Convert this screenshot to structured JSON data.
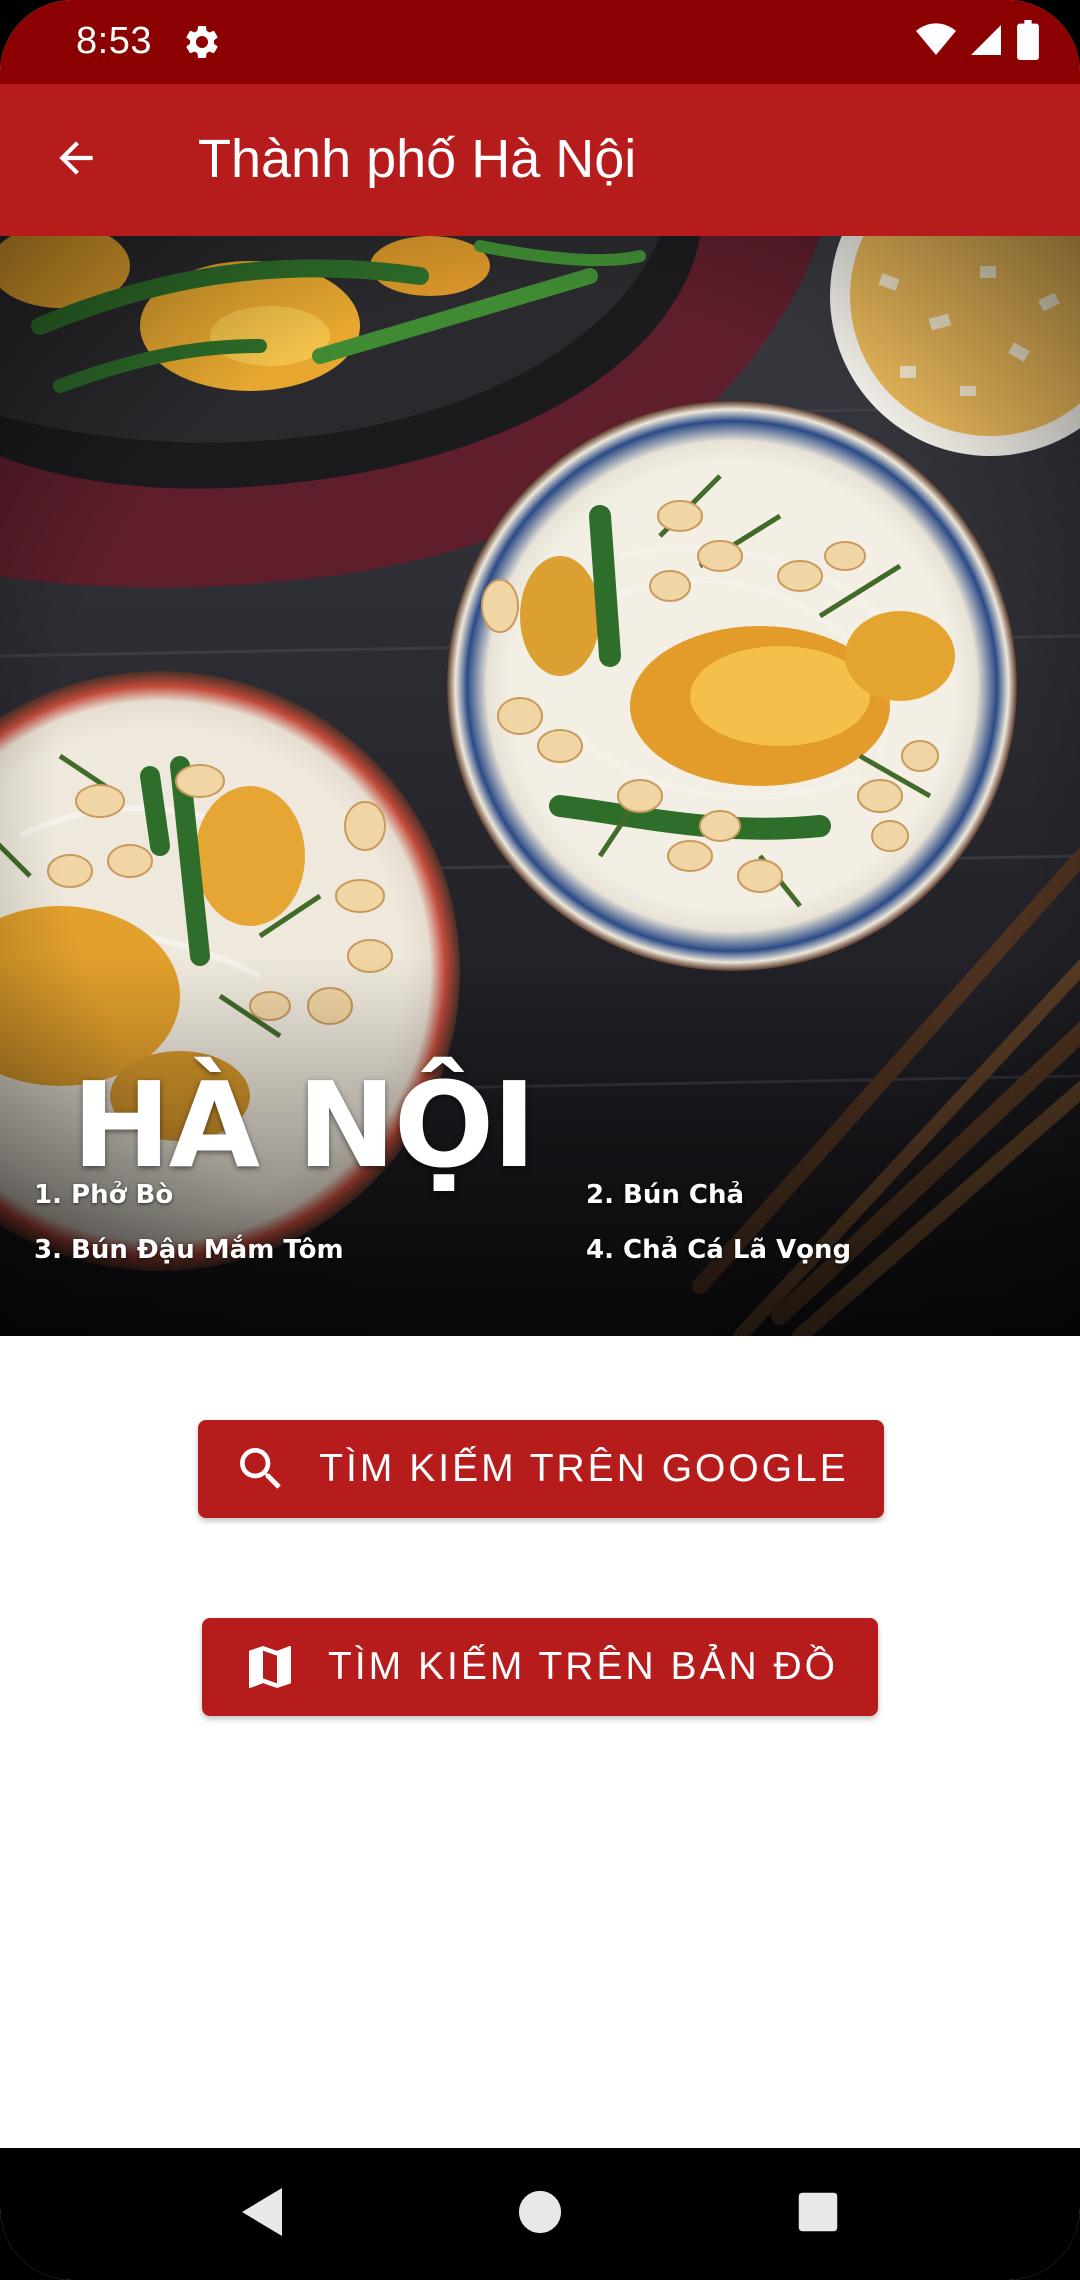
{
  "status_bar": {
    "time": "8:53",
    "icons": [
      "gear-icon",
      "wifi-icon",
      "cellular-icon",
      "battery-icon"
    ]
  },
  "app_bar": {
    "title": "Thành phố Hà Nội",
    "back_icon": "arrow-back-icon"
  },
  "hero": {
    "city": "HÀ NỘI",
    "dishes": [
      "1.  Phở Bò",
      "2. Bún Chả",
      "3. Bún Đậu Mắm Tôm",
      "4. Chả Cá Lã Vọng"
    ]
  },
  "actions": {
    "google_search_label": "TÌM KIẾM TRÊN GOOGLE",
    "google_search_icon": "search-icon",
    "map_search_label": "TÌM KIẾM TRÊN BẢN ĐỒ",
    "map_search_icon": "map-icon"
  },
  "nav_bar": {
    "icons": [
      "back-triangle-icon",
      "home-circle-icon",
      "recents-square-icon"
    ]
  },
  "colors": {
    "status_bar": "#8b0000",
    "app_bar": "#b71c1c",
    "button": "#b71c1c"
  }
}
